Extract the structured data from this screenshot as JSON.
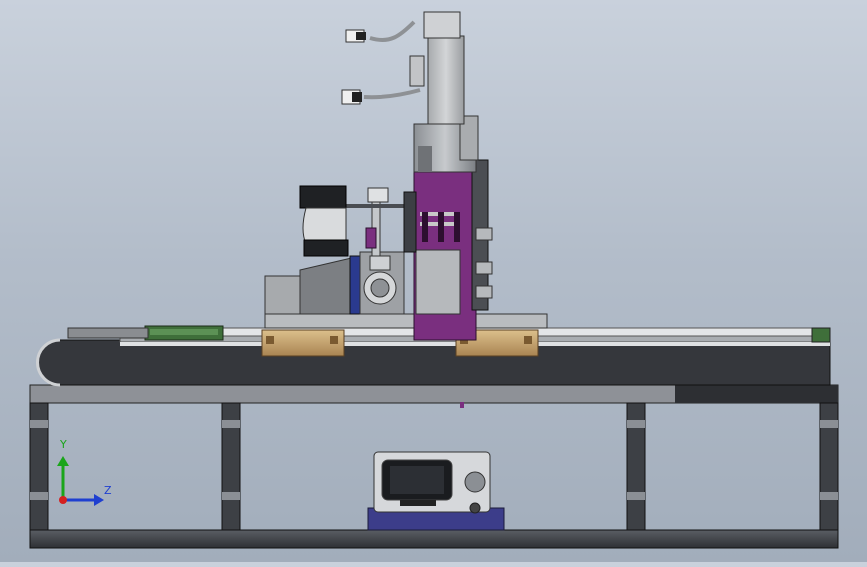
{
  "viewport": {
    "background_top": "#c9d1dc",
    "background_bottom": "#a2adbb"
  },
  "triad": {
    "y_label": "Y",
    "z_label": "Z",
    "y_color": "#1aa51a",
    "z_color": "#1f3fd0",
    "origin_color": "#d42020"
  },
  "model": {
    "accent_color": "#7a2f7f",
    "slider_color": "#c9a46a",
    "frame_color": "#3a3d42",
    "rail_color": "#d6d8db",
    "cable_chain_color": "#2f3136",
    "green_part_color": "#3f6f3a"
  }
}
